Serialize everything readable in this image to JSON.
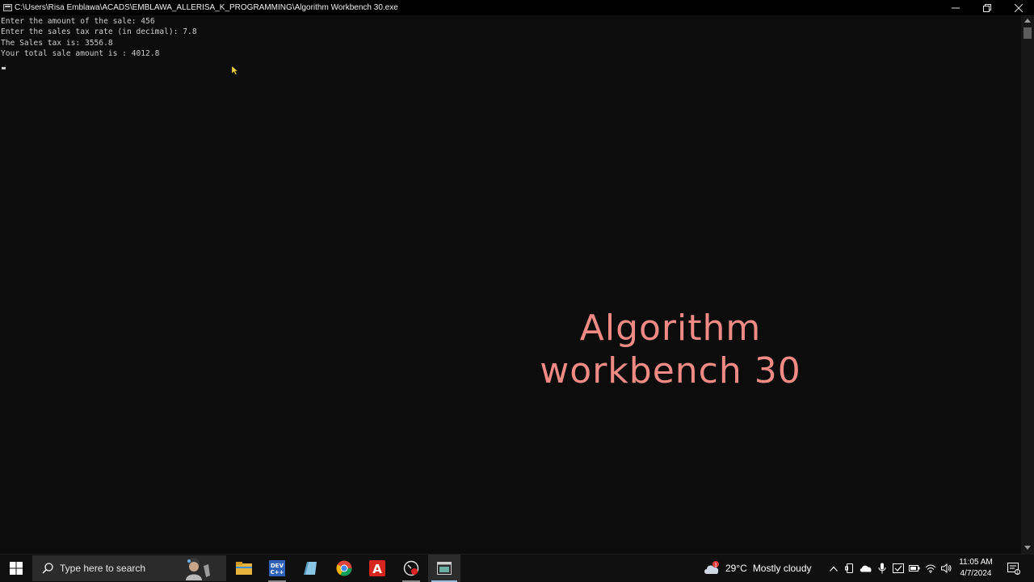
{
  "window": {
    "title": "C:\\Users\\Risa Emblawa\\ACADS\\EMBLAWA_ALLERISA_K_PROGRAMMING\\Algorithm Workbench 30.exe",
    "icon": "console-app-icon",
    "controls": {
      "minimize": "minimize-icon",
      "restore": "restore-icon",
      "close": "close-icon"
    }
  },
  "console": {
    "lines": [
      "Enter the amount of the sale: 456",
      "Enter the sales tax rate (in decimal): 7.8",
      "The Sales tax is: 3556.8",
      "Your total sale amount is : 4012.8"
    ]
  },
  "overlay": {
    "line1": "Algorithm",
    "line2": "workbench 30",
    "color": "#ef8a84"
  },
  "taskbar": {
    "start_icon": "windows-start-icon",
    "search": {
      "placeholder": "Type here to search"
    },
    "apps": [
      {
        "name": "file-explorer-icon"
      },
      {
        "name": "dev-cpp-icon"
      },
      {
        "name": "notes-app-icon"
      },
      {
        "name": "chrome-icon"
      },
      {
        "name": "acrobat-icon"
      },
      {
        "name": "screen-recorder-icon"
      },
      {
        "name": "console-window-icon"
      }
    ],
    "weather": {
      "badge": "1",
      "temperature": "29°C",
      "condition": "Mostly cloudy"
    },
    "clock": {
      "time": "11:05 AM",
      "date": "4/7/2024"
    }
  },
  "colors": {
    "console_bg": "#0c0c0c",
    "console_text": "#cccccc",
    "taskbar_bg": "#101010",
    "accent": "#9bbcd8"
  }
}
